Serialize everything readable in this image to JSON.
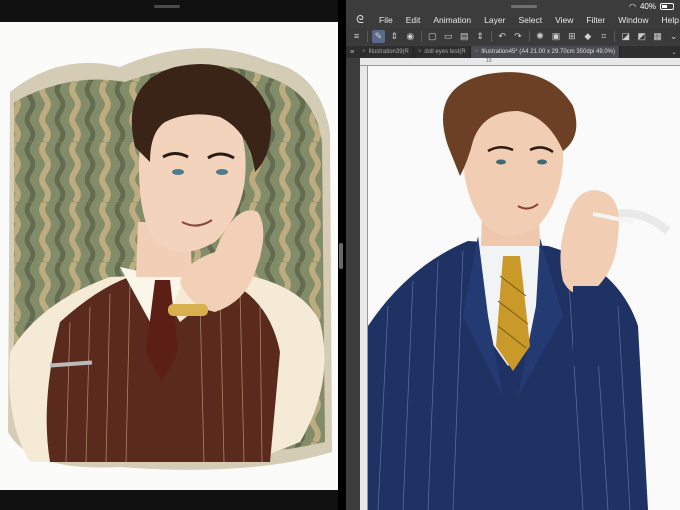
{
  "right_pane": {
    "status": {
      "battery": "40%"
    },
    "menu": [
      "File",
      "Edit",
      "Animation",
      "Layer",
      "Select",
      "View",
      "Filter",
      "Window",
      "Help"
    ],
    "tabs": [
      {
        "label": "Illustration39(R"
      },
      {
        "label": "doll eyes test(R"
      },
      {
        "label": "Illustration45* (A4 21.00 x 29.70cm 350dpi 49.0%)"
      }
    ],
    "ruler_mark": "10"
  },
  "colors": {
    "suit": "#1f3264",
    "vest": "#5a2a1c",
    "hair_left": "#3a2418",
    "hair_right": "#6b4024",
    "tie": "#c99a2a",
    "backdrop": "#6f7a55"
  }
}
